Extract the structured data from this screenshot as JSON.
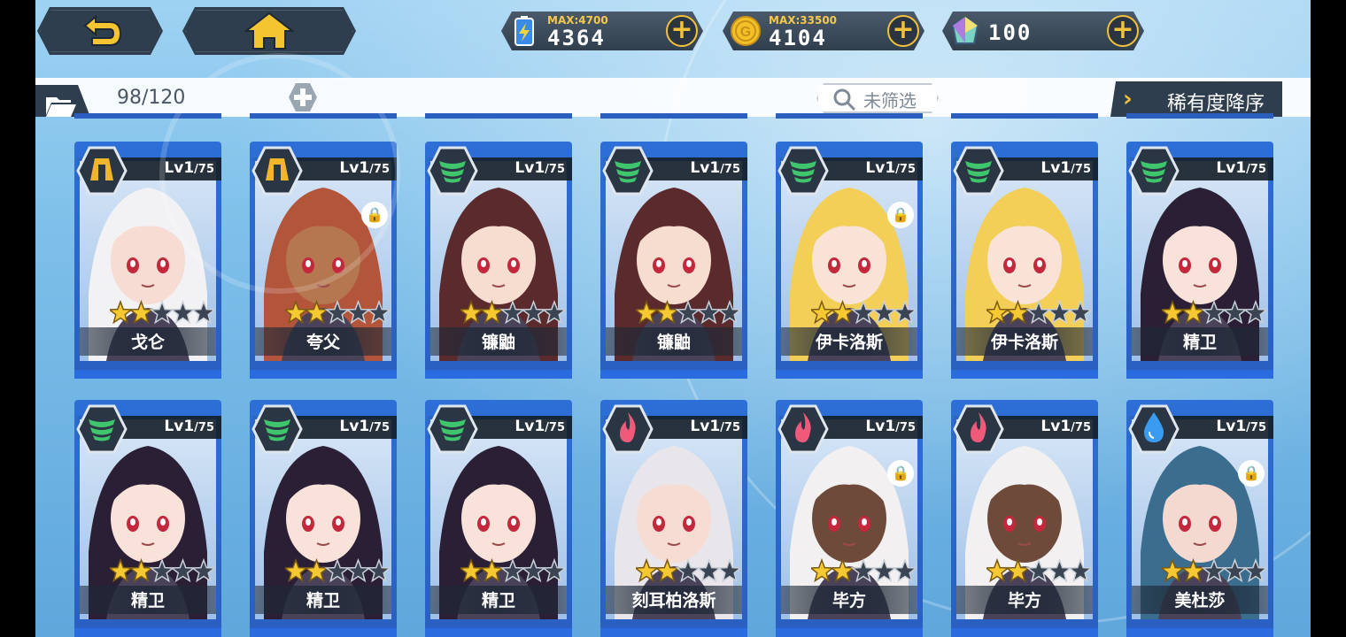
{
  "resources": [
    {
      "id": "energy",
      "max": "MAX:4700",
      "value": "4364",
      "icon": "battery-icon"
    },
    {
      "id": "gold",
      "max": "MAX:33500",
      "value": "4104",
      "icon": "gold-coin-icon"
    },
    {
      "id": "gem",
      "max": "",
      "value": "100",
      "icon": "crystal-icon"
    }
  ],
  "inventory": {
    "count": "98/120"
  },
  "filter": {
    "label": "未筛选"
  },
  "sort": {
    "label": "稀有度降序"
  },
  "cards": [
    {
      "name": "戈仑",
      "level": "Lv1",
      "max_level": "/75",
      "element": "earth",
      "element_color": "#f0b52a",
      "stars": 2,
      "locked": false,
      "hair": "#f2f2f5",
      "skin": "#f6dcd2"
    },
    {
      "name": "夸父",
      "level": "Lv1",
      "max_level": "/75",
      "element": "earth",
      "element_color": "#f0b52a",
      "stars": 2,
      "locked": true,
      "hair": "#b3553b",
      "skin": "#b4774f"
    },
    {
      "name": "镰鼬",
      "level": "Lv1",
      "max_level": "/75",
      "element": "wind",
      "element_color": "#3fc66d",
      "stars": 2,
      "locked": false,
      "hair": "#5a2a2c",
      "skin": "#f7ddcf"
    },
    {
      "name": "镰鼬",
      "level": "Lv1",
      "max_level": "/75",
      "element": "wind",
      "element_color": "#3fc66d",
      "stars": 2,
      "locked": false,
      "hair": "#5a2a2c",
      "skin": "#f7ddcf"
    },
    {
      "name": "伊卡洛斯",
      "level": "Lv1",
      "max_level": "/75",
      "element": "wind",
      "element_color": "#3fc66d",
      "stars": 2,
      "locked": true,
      "hair": "#f3cf57",
      "skin": "#f8e3d6"
    },
    {
      "name": "伊卡洛斯",
      "level": "Lv1",
      "max_level": "/75",
      "element": "wind",
      "element_color": "#3fc66d",
      "stars": 2,
      "locked": false,
      "hair": "#f3cf57",
      "skin": "#f8e3d6"
    },
    {
      "name": "精卫",
      "level": "Lv1",
      "max_level": "/75",
      "element": "wind",
      "element_color": "#3fc66d",
      "stars": 2,
      "locked": false,
      "hair": "#2b1f35",
      "skin": "#f8e2da"
    },
    {
      "name": "精卫",
      "level": "Lv1",
      "max_level": "/75",
      "element": "wind",
      "element_color": "#3fc66d",
      "stars": 2,
      "locked": false,
      "hair": "#2b1f35",
      "skin": "#f8e2da"
    },
    {
      "name": "精卫",
      "level": "Lv1",
      "max_level": "/75",
      "element": "wind",
      "element_color": "#3fc66d",
      "stars": 2,
      "locked": false,
      "hair": "#2b1f35",
      "skin": "#f8e2da"
    },
    {
      "name": "精卫",
      "level": "Lv1",
      "max_level": "/75",
      "element": "wind",
      "element_color": "#3fc66d",
      "stars": 2,
      "locked": false,
      "hair": "#2b1f35",
      "skin": "#f8e2da"
    },
    {
      "name": "刻耳柏洛斯",
      "level": "Lv1",
      "max_level": "/75",
      "element": "fire",
      "element_color": "#ef5a7a",
      "stars": 2,
      "locked": false,
      "hair": "#e8e6ea",
      "skin": "#f7dcd3"
    },
    {
      "name": "毕方",
      "level": "Lv1",
      "max_level": "/75",
      "element": "fire",
      "element_color": "#ef5a7a",
      "stars": 2,
      "locked": true,
      "hair": "#f2f0f0",
      "skin": "#6e4a3a"
    },
    {
      "name": "毕方",
      "level": "Lv1",
      "max_level": "/75",
      "element": "fire",
      "element_color": "#ef5a7a",
      "stars": 2,
      "locked": false,
      "hair": "#f2f0f0",
      "skin": "#6e4a3a"
    },
    {
      "name": "美杜莎",
      "level": "Lv1",
      "max_level": "/75",
      "element": "water",
      "element_color": "#3a9cf0",
      "stars": 2,
      "locked": true,
      "hair": "#3b6d8e",
      "skin": "#f3d9cf"
    }
  ]
}
